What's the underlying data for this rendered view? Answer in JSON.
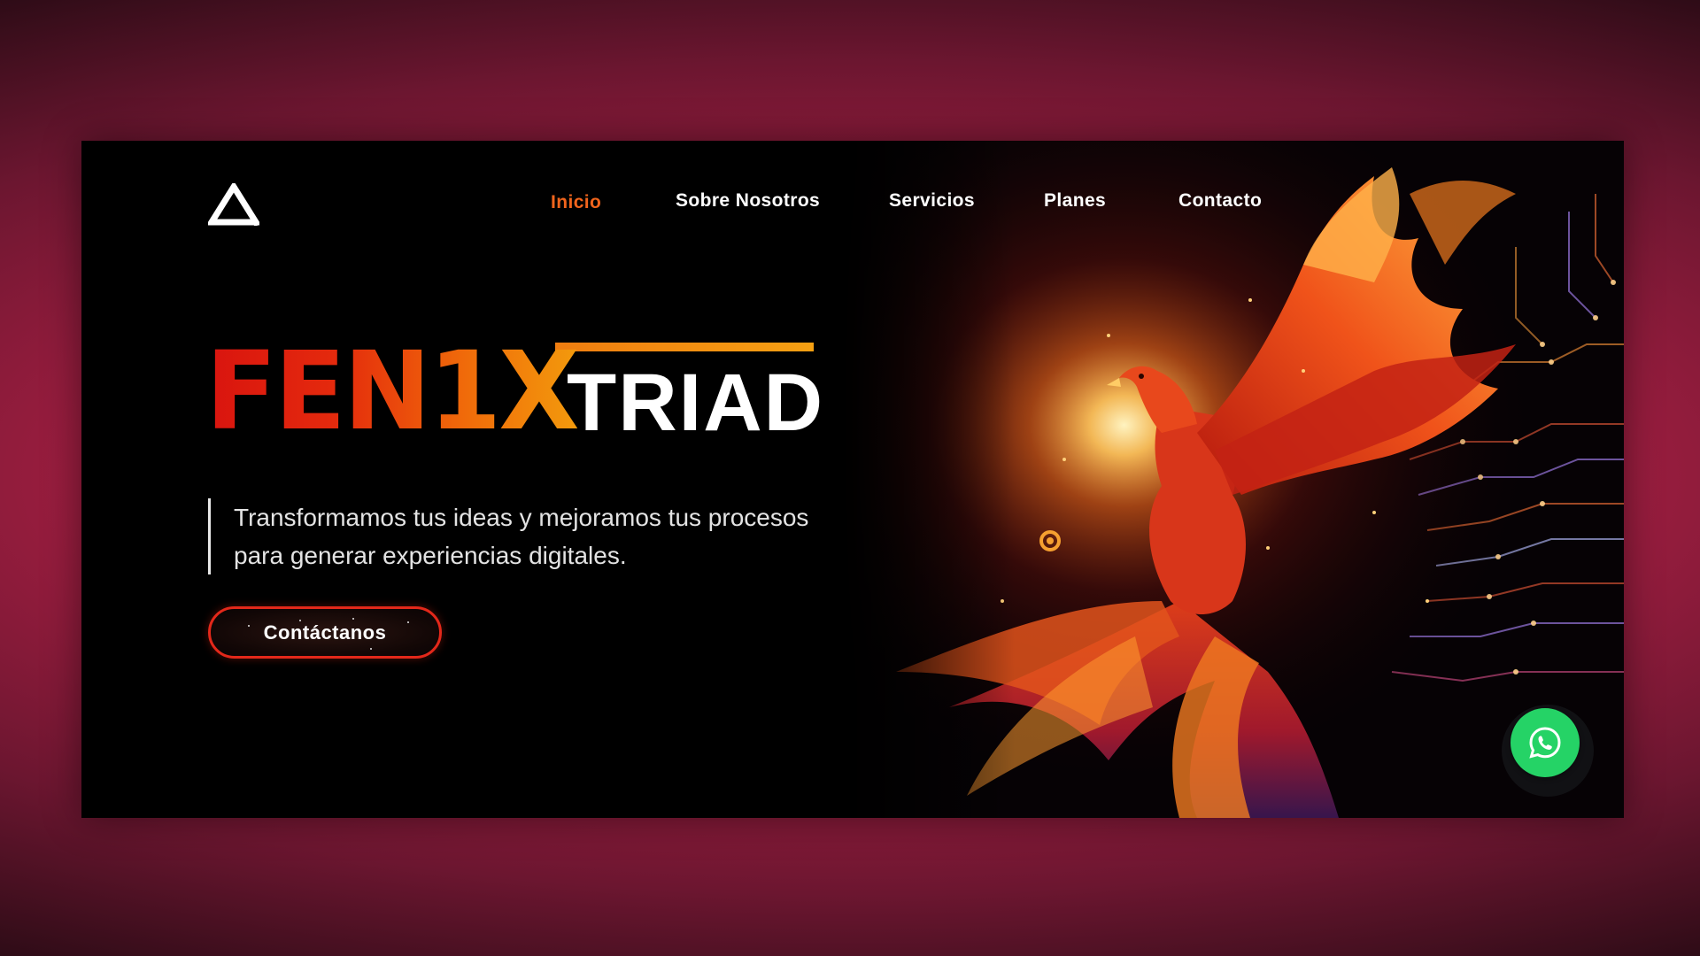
{
  "header": {
    "logo_icon": "triangle-logo-icon",
    "nav": [
      {
        "label": "Inicio",
        "active": true
      },
      {
        "label": "Sobre Nosotros",
        "active": false
      },
      {
        "label": "Servicios",
        "active": false
      },
      {
        "label": "Planes",
        "active": false
      },
      {
        "label": "Contacto",
        "active": false
      }
    ]
  },
  "hero": {
    "brand_part1": "FEN1X",
    "brand_part2": "TRIAD",
    "tagline_line1": "Transformamos tus ideas y mejoramos tus procesos",
    "tagline_line2": "para generar experiencias digitales.",
    "cta_label": "Contáctanos",
    "artwork": "phoenix-circuit-illustration"
  },
  "floating": {
    "whatsapp_icon": "whatsapp-icon"
  },
  "colors": {
    "accent": "#f0641c",
    "brand_red": "#d9140f",
    "brand_orange": "#f39a0c",
    "cta_border": "#e3281a",
    "whatsapp": "#25d366",
    "background_magenta": "#bb2048"
  }
}
